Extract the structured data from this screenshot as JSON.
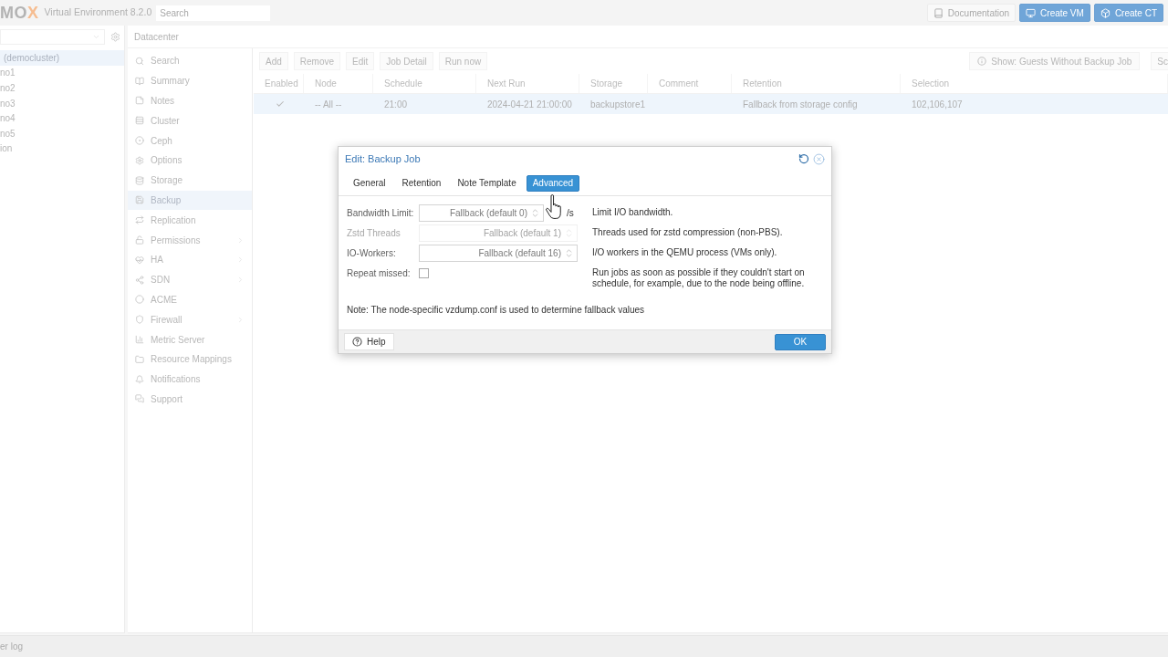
{
  "header": {
    "logo_text": "MO",
    "logo_accent": "X",
    "product": "Virtual Environment 8.2.0",
    "search": {
      "placeholder": "Search"
    },
    "buttons": [
      {
        "label": "Documentation",
        "kind": "plain"
      },
      {
        "label": "Create VM",
        "kind": "primary"
      },
      {
        "label": "Create CT",
        "kind": "primary"
      }
    ]
  },
  "tree": {
    "items": [
      {
        "label": "(democluster)",
        "selected": true
      },
      {
        "label": "no1",
        "selected": false
      },
      {
        "label": "no2",
        "selected": false
      },
      {
        "label": "no3",
        "selected": false
      },
      {
        "label": "no4",
        "selected": false
      },
      {
        "label": "no5",
        "selected": false
      },
      {
        "label": "ion",
        "selected": false
      }
    ]
  },
  "breadcrumb": "Datacenter",
  "menu": {
    "items": [
      {
        "label": "Search",
        "selected": false,
        "expandable": false
      },
      {
        "label": "Summary",
        "selected": false,
        "expandable": false
      },
      {
        "label": "Notes",
        "selected": false,
        "expandable": false
      },
      {
        "label": "Cluster",
        "selected": false,
        "expandable": false
      },
      {
        "label": "Ceph",
        "selected": false,
        "expandable": false
      },
      {
        "label": "Options",
        "selected": false,
        "expandable": false
      },
      {
        "label": "Storage",
        "selected": false,
        "expandable": false
      },
      {
        "label": "Backup",
        "selected": true,
        "expandable": false
      },
      {
        "label": "Replication",
        "selected": false,
        "expandable": false
      },
      {
        "label": "Permissions",
        "selected": false,
        "expandable": true
      },
      {
        "label": "HA",
        "selected": false,
        "expandable": true
      },
      {
        "label": "SDN",
        "selected": false,
        "expandable": true
      },
      {
        "label": "ACME",
        "selected": false,
        "expandable": false
      },
      {
        "label": "Firewall",
        "selected": false,
        "expandable": true
      },
      {
        "label": "Metric Server",
        "selected": false,
        "expandable": false
      },
      {
        "label": "Resource Mappings",
        "selected": false,
        "expandable": false
      },
      {
        "label": "Notifications",
        "selected": false,
        "expandable": false
      },
      {
        "label": "Support",
        "selected": false,
        "expandable": false
      }
    ]
  },
  "toolbar": {
    "buttons": [
      "Add",
      "Remove",
      "Edit",
      "Job Detail",
      "Run now"
    ],
    "info_button": "Show: Guests Without Backup Job",
    "cut_button": "Sc"
  },
  "table": {
    "columns": [
      "Enabled",
      "Node",
      "Schedule",
      "Next Run",
      "Storage",
      "Comment",
      "Retention",
      "Selection"
    ],
    "rows": [
      {
        "selected": true,
        "enabled": true,
        "node": "-- All --",
        "schedule": "21:00",
        "next_run": "2024-04-21 21:00:00",
        "storage": "backupstore1",
        "retention": "Fallback from storage config",
        "selection": "102,106,107"
      }
    ]
  },
  "dialog": {
    "title": "Edit: Backup Job",
    "tabs": [
      {
        "label": "General",
        "selected": false
      },
      {
        "label": "Retention",
        "selected": false
      },
      {
        "label": "Note Template",
        "selected": false
      },
      {
        "label": "Advanced",
        "selected": true
      }
    ],
    "fields": [
      {
        "kind": "number",
        "label": "Bandwidth Limit:",
        "placeholder": "Fallback (default 0)",
        "unit": "/s",
        "disabled": false,
        "description": "Limit I/O bandwidth."
      },
      {
        "kind": "number",
        "label": "Zstd Threads",
        "placeholder": "Fallback (default 1)",
        "disabled": true,
        "description": "Threads used for zstd compression (non-PBS)."
      },
      {
        "kind": "number",
        "label": "IO-Workers:",
        "placeholder": "Fallback (default 16)",
        "disabled": false,
        "description": "I/O workers in the QEMU process (VMs only)."
      },
      {
        "kind": "checkbox",
        "label": "Repeat missed:",
        "checked": false,
        "disabled": false,
        "description": "Run jobs as soon as possible if they couldn't start on schedule, for example, due to the node being offline."
      }
    ],
    "note": "Note: The node-specific vzdump.conf is used to determine fallback values",
    "help_button": "Help",
    "ok_button": "OK"
  },
  "status_bar": {
    "label": "er log"
  }
}
